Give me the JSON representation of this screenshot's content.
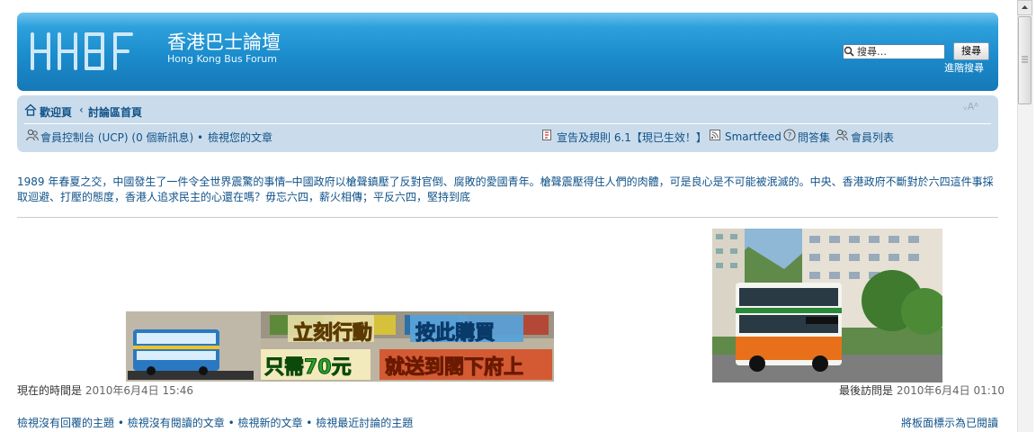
{
  "header": {
    "site_title": "香港巴士論壇",
    "site_subtitle": "Hong Kong Bus Forum",
    "search_placeholder": "搜尋…",
    "search_button": "搜尋",
    "advanced_search": "進階搜尋"
  },
  "navbar": {
    "breadcrumb_home": "歡迎頁",
    "breadcrumb_sep": "‹",
    "breadcrumb_index": "討論區首頁",
    "font_size_label": "ᵥAᴬ",
    "ucp_link": "會員控制台 (UCP)",
    "ucp_messages": " (0 個新訊息) • ",
    "view_posts": "檢視您的文章",
    "rules_link": "宣告及規則 6.1【現已生效！】",
    "feed_link": "Smartfeed",
    "faq_link": "問答集",
    "members_link": "會員列表"
  },
  "announcement": {
    "text": "1989 年春夏之交，中國發生了一件令全世界震驚的事情─中國政府以槍聲鎮壓了反對官倒、腐敗的愛國青年。槍聲震壓得住人們的肉體，可是良心是不可能被泯滅的。中央、香港政府不斷對於六四這件事採取迴避、打壓的態度，香港人追求民主的心還在嗎？毋忘六四，薪火相傳；平反六四，堅持到底"
  },
  "ad_banner": {
    "line1_left": "立刻行動",
    "line1_right": "按此購買",
    "line2_left": "只需70元",
    "line2_right": "就送到閣下府上"
  },
  "times": {
    "current_label": "現在的時間是",
    "current_value": "2010年6月4日 15:46",
    "last_label": "最後訪問是",
    "last_value": "2010年6月4日 01:10"
  },
  "quick_links": {
    "unanswered": "檢視沒有回覆的主題",
    "unread": "檢視沒有閱讀的文章",
    "new_posts": "檢視新的文章",
    "active": "檢視最近討論的主題",
    "sep": " • ",
    "mark_read": "將板面標示為已閱讀"
  }
}
